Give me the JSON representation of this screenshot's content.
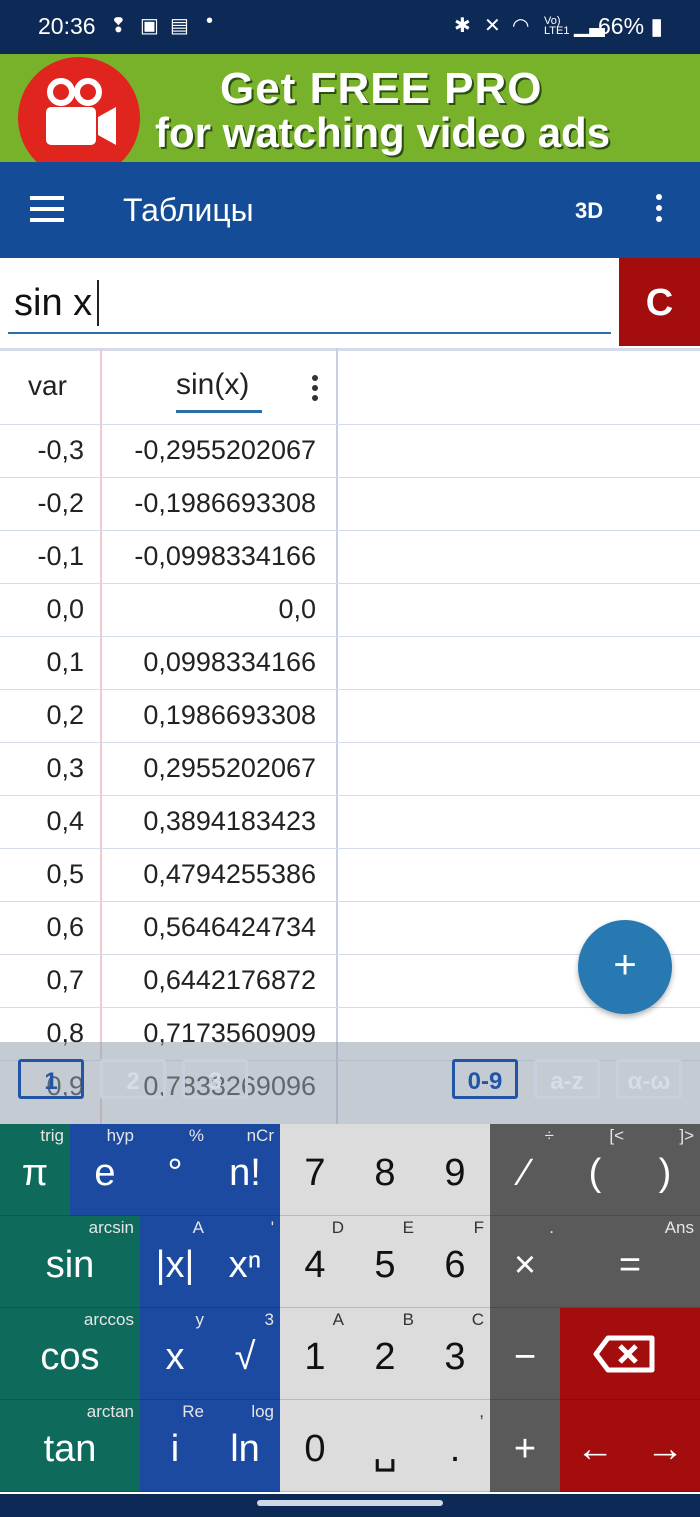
{
  "status_bar": {
    "time": "20:36",
    "battery": "66%"
  },
  "ad": {
    "line1": "Get FREE PRO",
    "line2": "for watching video ads"
  },
  "toolbar": {
    "title": "Таблицы",
    "btn_3d": "3D"
  },
  "input": {
    "value": "sin x",
    "clear_label": "C"
  },
  "table": {
    "columns": [
      "var",
      "sin(x)"
    ],
    "rows": [
      {
        "x": "-0,3",
        "y": "-0,2955202067"
      },
      {
        "x": "-0,2",
        "y": "-0,1986693308"
      },
      {
        "x": "-0,1",
        "y": "-0,0998334166"
      },
      {
        "x": "0,0",
        "y": "0,0"
      },
      {
        "x": "0,1",
        "y": "0,0998334166"
      },
      {
        "x": "0,2",
        "y": "0,1986693308"
      },
      {
        "x": "0,3",
        "y": "0,2955202067"
      },
      {
        "x": "0,4",
        "y": "0,3894183423"
      },
      {
        "x": "0,5",
        "y": "0,4794255386"
      },
      {
        "x": "0,6",
        "y": "0,5646424734"
      },
      {
        "x": "0,7",
        "y": "0,6442176872"
      },
      {
        "x": "0,8",
        "y": "0,7173560909"
      },
      {
        "x": "0,9",
        "y": "0,7833269096"
      }
    ]
  },
  "fab_label": "+",
  "keyboard_tabs": [
    "1",
    "2",
    "3",
    "0-9",
    "a-z",
    "α-ω"
  ],
  "keys": {
    "pi": {
      "main": "π",
      "sub": "trig"
    },
    "e": {
      "main": "e",
      "sub": "hyp"
    },
    "deg": {
      "main": "°",
      "sub": "%"
    },
    "fact": {
      "main": "n!",
      "sub": "nCr"
    },
    "k7": {
      "main": "7"
    },
    "k8": {
      "main": "8"
    },
    "k9": {
      "main": "9"
    },
    "div": {
      "main": "⁄",
      "sub": "÷"
    },
    "lparen": {
      "main": "(",
      "sub": "[<"
    },
    "rparen": {
      "main": ")",
      "sub": "]>"
    },
    "sin": {
      "main": "sin",
      "sub": "arcsin"
    },
    "abs": {
      "main": "|x|",
      "sub": "A"
    },
    "pow": {
      "main": "xⁿ",
      "sub": "'"
    },
    "k4": {
      "main": "4",
      "sub": "D"
    },
    "k5": {
      "main": "5",
      "sub": "E"
    },
    "k6": {
      "main": "6",
      "sub": "F"
    },
    "mul": {
      "main": "×",
      "sub": "."
    },
    "eq": {
      "main": "=",
      "sub": "Ans"
    },
    "cos": {
      "main": "cos",
      "sub": "arccos"
    },
    "x": {
      "main": "x",
      "sub": "y"
    },
    "sqrt": {
      "main": "√",
      "sub": "3"
    },
    "k1": {
      "main": "1",
      "sub": "A"
    },
    "k2": {
      "main": "2",
      "sub": "B"
    },
    "k3": {
      "main": "3",
      "sub": "C"
    },
    "minus": {
      "main": "−"
    },
    "tan": {
      "main": "tan",
      "sub": "arctan"
    },
    "i": {
      "main": "i",
      "sub": "Re"
    },
    "ln": {
      "main": "ln",
      "sub": "log"
    },
    "k0": {
      "main": "0"
    },
    "space": {
      "main": "␣"
    },
    "dot": {
      "main": ".",
      "sub": ","
    },
    "plus": {
      "main": "+"
    },
    "left": {
      "main": "←"
    },
    "right": {
      "main": "→"
    }
  },
  "colors": {
    "status_bar": "#0d2a56",
    "ad_bg": "#78b22b",
    "toolbar": "#144c98",
    "clear_btn": "#a30d0d",
    "fab": "#2878b2",
    "kb_green": "#0e6b5b",
    "kb_blue": "#1b4aa0",
    "kb_light": "#dcdcdc",
    "kb_dark": "#5a5a5a",
    "kb_red": "#a30d0d"
  }
}
